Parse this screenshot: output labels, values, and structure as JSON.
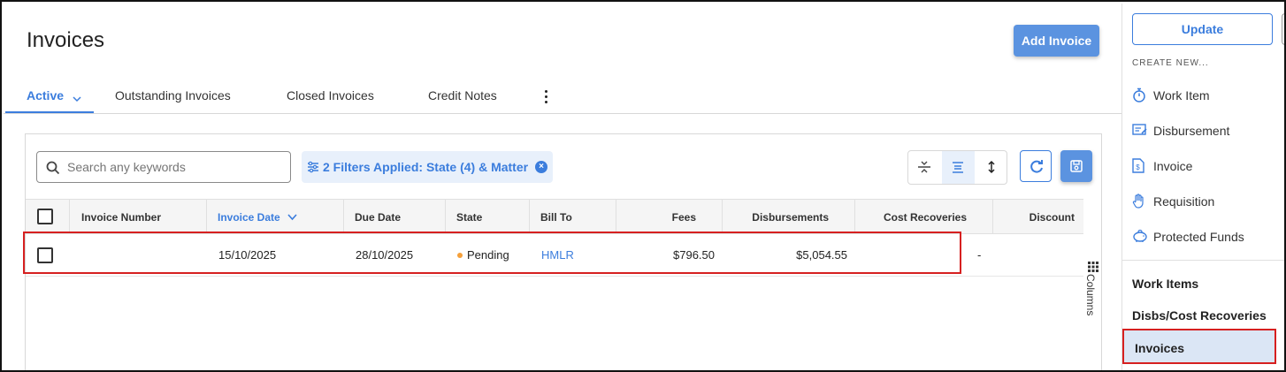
{
  "header": {
    "title": "Invoices",
    "add_button": "Add Invoice"
  },
  "tabs": [
    {
      "label": "Active",
      "active": true
    },
    {
      "label": "Outstanding Invoices"
    },
    {
      "label": "Closed Invoices"
    },
    {
      "label": "Credit Notes"
    }
  ],
  "toolbar": {
    "search_placeholder": "Search any keywords",
    "filter_label": "2 Filters Applied: State (4) & Matter"
  },
  "table": {
    "columns": [
      "Invoice Number",
      "Invoice Date",
      "Due Date",
      "State",
      "Bill To",
      "Fees",
      "Disbursements",
      "Cost Recoveries",
      "Discount"
    ],
    "sorted_column": "Invoice Date",
    "rows": [
      {
        "invoice_number": "",
        "invoice_date": "15/10/2025",
        "due_date": "28/10/2025",
        "state": "Pending",
        "bill_to": "HMLR",
        "fees": "$796.50",
        "disbursements": "$5,054.55",
        "cost_recoveries": "",
        "discount": "-"
      }
    ],
    "columns_toggle": "Columns"
  },
  "sidebar": {
    "update_button": "Update",
    "create_new_heading": "CREATE NEW...",
    "create_items": [
      {
        "label": "Work Item",
        "icon": "stopwatch-icon"
      },
      {
        "label": "Disbursement",
        "icon": "receipt-icon"
      },
      {
        "label": "Invoice",
        "icon": "invoice-icon"
      },
      {
        "label": "Requisition",
        "icon": "hand-icon"
      },
      {
        "label": "Protected Funds",
        "icon": "piggy-bank-icon"
      }
    ],
    "nav": [
      {
        "label": "Work Items"
      },
      {
        "label": "Disbs/Cost Recoveries"
      },
      {
        "label": "Invoices",
        "selected": true
      }
    ]
  },
  "colors": {
    "accent": "#3b7ddd",
    "primary_button": "#5b93e0",
    "pending": "#f5a03a",
    "highlight_border": "#d62020",
    "selected_nav": "#dbe6f5"
  }
}
